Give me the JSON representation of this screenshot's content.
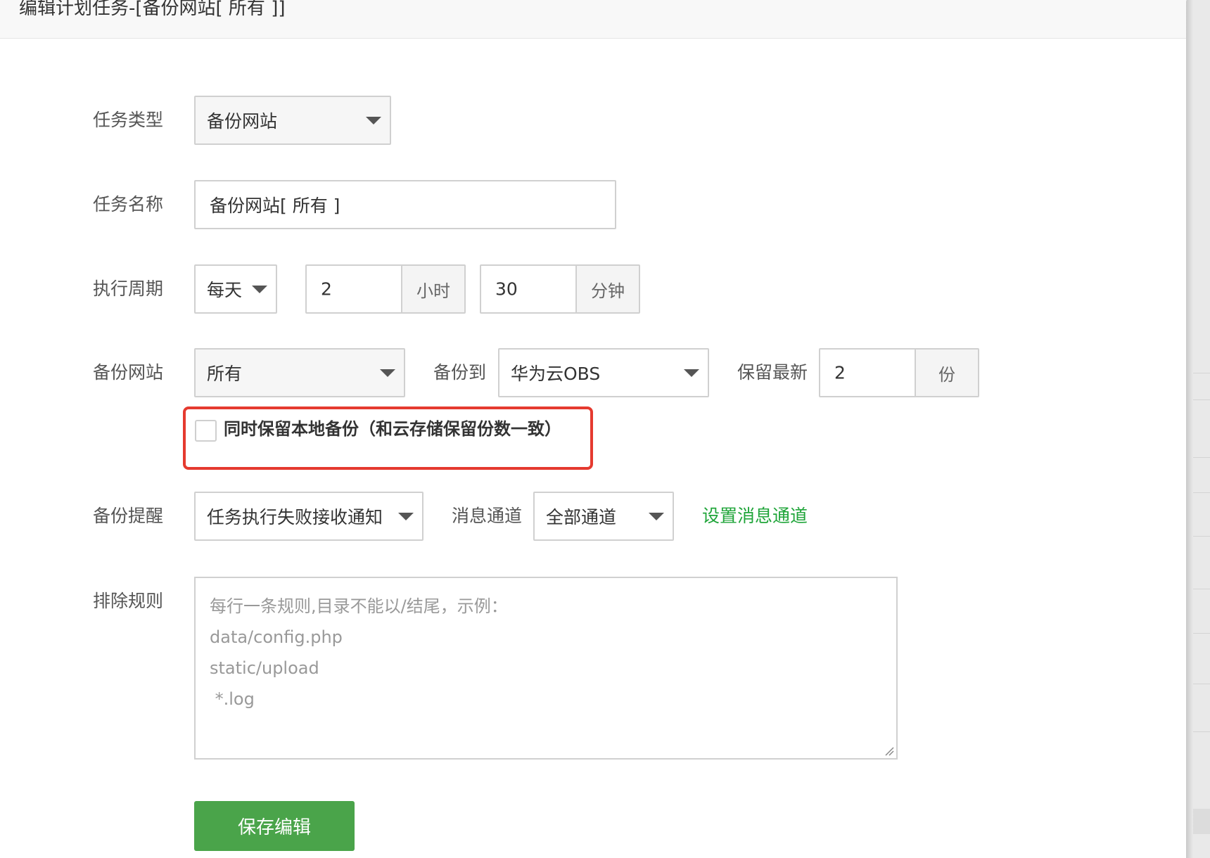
{
  "dialog": {
    "title": "编辑计划任务-[备份网站[ 所有 ]]"
  },
  "form": {
    "task_type": {
      "label": "任务类型",
      "value": "备份网站"
    },
    "task_name": {
      "label": "任务名称",
      "value": "备份网站[ 所有 ]"
    },
    "cycle": {
      "label": "执行周期",
      "period": "每天",
      "hour_value": "2",
      "hour_unit": "小时",
      "minute_value": "30",
      "minute_unit": "分钟"
    },
    "backup_site": {
      "label": "备份网站",
      "value": "所有",
      "backup_to_label": "备份到",
      "backup_to_value": "华为云OBS",
      "keep_label": "保留最新",
      "keep_value": "2",
      "keep_unit": "份"
    },
    "keep_local": {
      "label": "同时保留本地备份（和云存储保留份数一致）",
      "checked": false
    },
    "notify": {
      "label": "备份提醒",
      "value": "任务执行失败接收通知",
      "channel_label": "消息通道",
      "channel_value": "全部通道",
      "setup_link": "设置消息通道"
    },
    "exclude": {
      "label": "排除规则",
      "placeholder_lines": [
        "每行一条规则,目录不能以/结尾，示例：",
        "data/config.php",
        "static/upload",
        " *.log"
      ]
    },
    "save_button": "保存编辑"
  },
  "colors": {
    "accent_green": "#20a53a",
    "button_green": "#4aa44a",
    "highlight_red": "#e53a2f"
  }
}
